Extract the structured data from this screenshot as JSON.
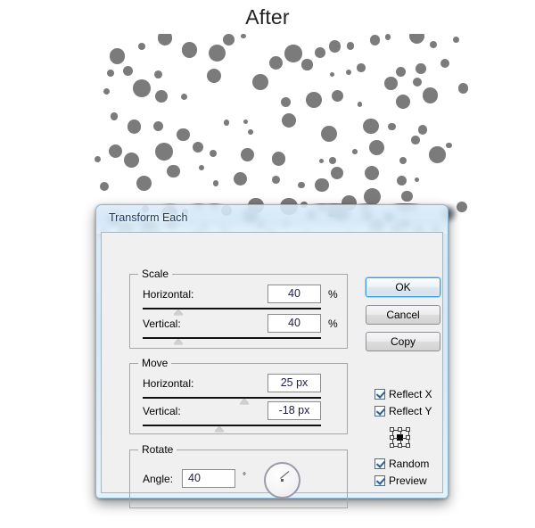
{
  "heading": "After",
  "artwork": {
    "name": "dot-pattern",
    "dot_color": "#7b7b7b",
    "description": "Randomly scattered gray circles of varying sizes"
  },
  "dialog": {
    "title": "Transform Each",
    "groups": {
      "scale": {
        "title": "Scale",
        "fields": [
          {
            "label": "Horizontal:",
            "value": "40",
            "unit": "%",
            "slider_pct": 20
          },
          {
            "label": "Vertical:",
            "value": "40",
            "unit": "%",
            "slider_pct": 20
          }
        ]
      },
      "move": {
        "title": "Move",
        "fields": [
          {
            "label": "Horizontal:",
            "value": "25 px",
            "unit": "",
            "slider_pct": 57
          },
          {
            "label": "Vertical:",
            "value": "-18 px",
            "unit": "",
            "slider_pct": 43
          }
        ]
      },
      "rotate": {
        "title": "Rotate",
        "fields": [
          {
            "label": "Angle:",
            "value": "40",
            "unit": "°",
            "dial_angle_deg": 40
          }
        ]
      }
    },
    "buttons": [
      {
        "label": "OK",
        "default": true
      },
      {
        "label": "Cancel",
        "default": false
      },
      {
        "label": "Copy",
        "default": false
      }
    ],
    "checkboxes": [
      {
        "label": "Reflect X",
        "checked": true
      },
      {
        "label": "Reflect Y",
        "checked": true
      },
      {
        "label": "Random",
        "checked": true
      },
      {
        "label": "Preview",
        "checked": true
      }
    ],
    "anchor": {
      "name": "reference-point-selector",
      "selected": "center"
    },
    "colors": {
      "titlebar_glass": "#cde5f7",
      "client_background": "#f0f0f0",
      "default_button_accent": "#3c9ddd",
      "input_text": "#1d1d4d"
    }
  }
}
